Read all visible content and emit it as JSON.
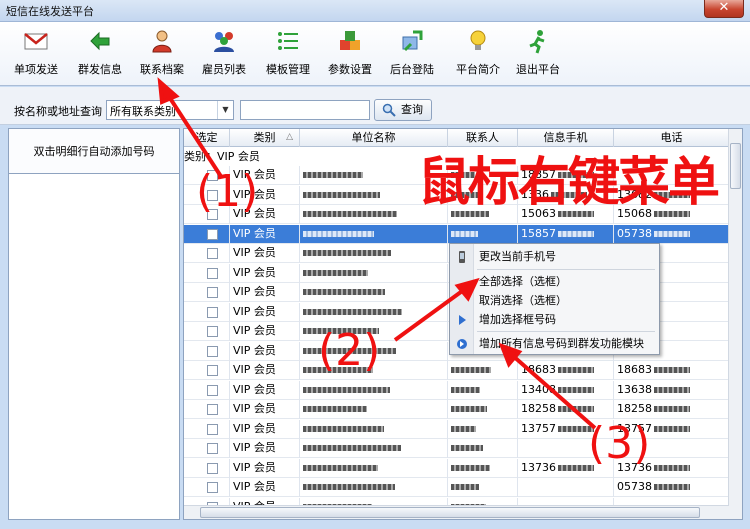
{
  "window": {
    "title": "短信在线发送平台",
    "close_glyph": "✕"
  },
  "toolbar": [
    {
      "label": "单项发送",
      "icon": "envelope-icon"
    },
    {
      "label": "群发信息",
      "icon": "arrow-left-icon"
    },
    {
      "label": "联系档案",
      "icon": "contact-person-icon"
    },
    {
      "label": "雇员列表",
      "icon": "group-people-icon"
    },
    {
      "label": "模板管理",
      "icon": "list-icon"
    },
    {
      "label": "参数设置",
      "icon": "cubes-icon"
    },
    {
      "label": "后台登陆",
      "icon": "refresh-arrows-icon"
    },
    {
      "label": "平台简介",
      "icon": "lightbulb-icon"
    },
    {
      "label": "退出平台",
      "icon": "running-man-icon"
    }
  ],
  "search": {
    "label": "按名称或地址查询",
    "scope_value": "所有联系类别",
    "input_value": "",
    "button_label": "查询"
  },
  "left_panel": {
    "header": "双击明细行自动添加号码"
  },
  "grid": {
    "columns": [
      "选定",
      "类别",
      "单位名称",
      "联系人",
      "信息手机",
      "电话"
    ],
    "sort_indicator": "△",
    "group_label": "类别：VIP 会员",
    "rows": [
      {
        "category": "VIP 会员",
        "mobile": "18857",
        "phone": "",
        "selected": false
      },
      {
        "category": "VIP 会员",
        "mobile": "1336",
        "phone": "13682",
        "selected": false
      },
      {
        "category": "VIP 会员",
        "mobile": "15063",
        "phone": "15068",
        "selected": false
      },
      {
        "category": "VIP 会员",
        "mobile": "15857",
        "phone": "05738",
        "selected": true
      },
      {
        "category": "VIP 会员",
        "mobile": "",
        "phone": "",
        "selected": false
      },
      {
        "category": "VIP 会员",
        "mobile": "",
        "phone": "",
        "selected": false
      },
      {
        "category": "VIP 会员",
        "mobile": "",
        "phone": "",
        "selected": false
      },
      {
        "category": "VIP 会员",
        "mobile": "",
        "phone": "",
        "selected": false
      },
      {
        "category": "VIP 会员",
        "mobile": "",
        "phone": "",
        "selected": false
      },
      {
        "category": "VIP 会员",
        "mobile": "",
        "phone": "",
        "selected": false
      },
      {
        "category": "VIP 会员",
        "mobile": "18683",
        "phone": "18683",
        "selected": false
      },
      {
        "category": "VIP 会员",
        "mobile": "13408",
        "phone": "13638",
        "selected": false
      },
      {
        "category": "VIP 会员",
        "mobile": "18258",
        "phone": "18258",
        "selected": false
      },
      {
        "category": "VIP 会员",
        "mobile": "13757",
        "phone": "13757",
        "selected": false
      },
      {
        "category": "VIP 会员",
        "mobile": "",
        "phone": "",
        "selected": false
      },
      {
        "category": "VIP 会员",
        "mobile": "13736",
        "phone": "13736",
        "selected": false
      },
      {
        "category": "VIP 会员",
        "mobile": "",
        "phone": "05738",
        "selected": false
      },
      {
        "category": "VIP 会员",
        "mobile": "",
        "phone": "",
        "selected": false
      }
    ]
  },
  "context_menu": {
    "items": [
      {
        "label": "更改当前手机号",
        "icon": "phone-icon"
      },
      {
        "label": "全部选择（选框）",
        "icon": ""
      },
      {
        "label": "取消选择（选框）",
        "icon": ""
      },
      {
        "label": "增加选择框号码",
        "icon": "blue-arrow-icon"
      },
      {
        "label": "增加所有信息号码到群发功能模块",
        "icon": "blue-double-arrow-icon"
      }
    ]
  },
  "annotations": {
    "title": "鼠标右键菜单",
    "markers": [
      "(1)",
      "(2)",
      "(3)"
    ],
    "color": "#ef1111"
  }
}
